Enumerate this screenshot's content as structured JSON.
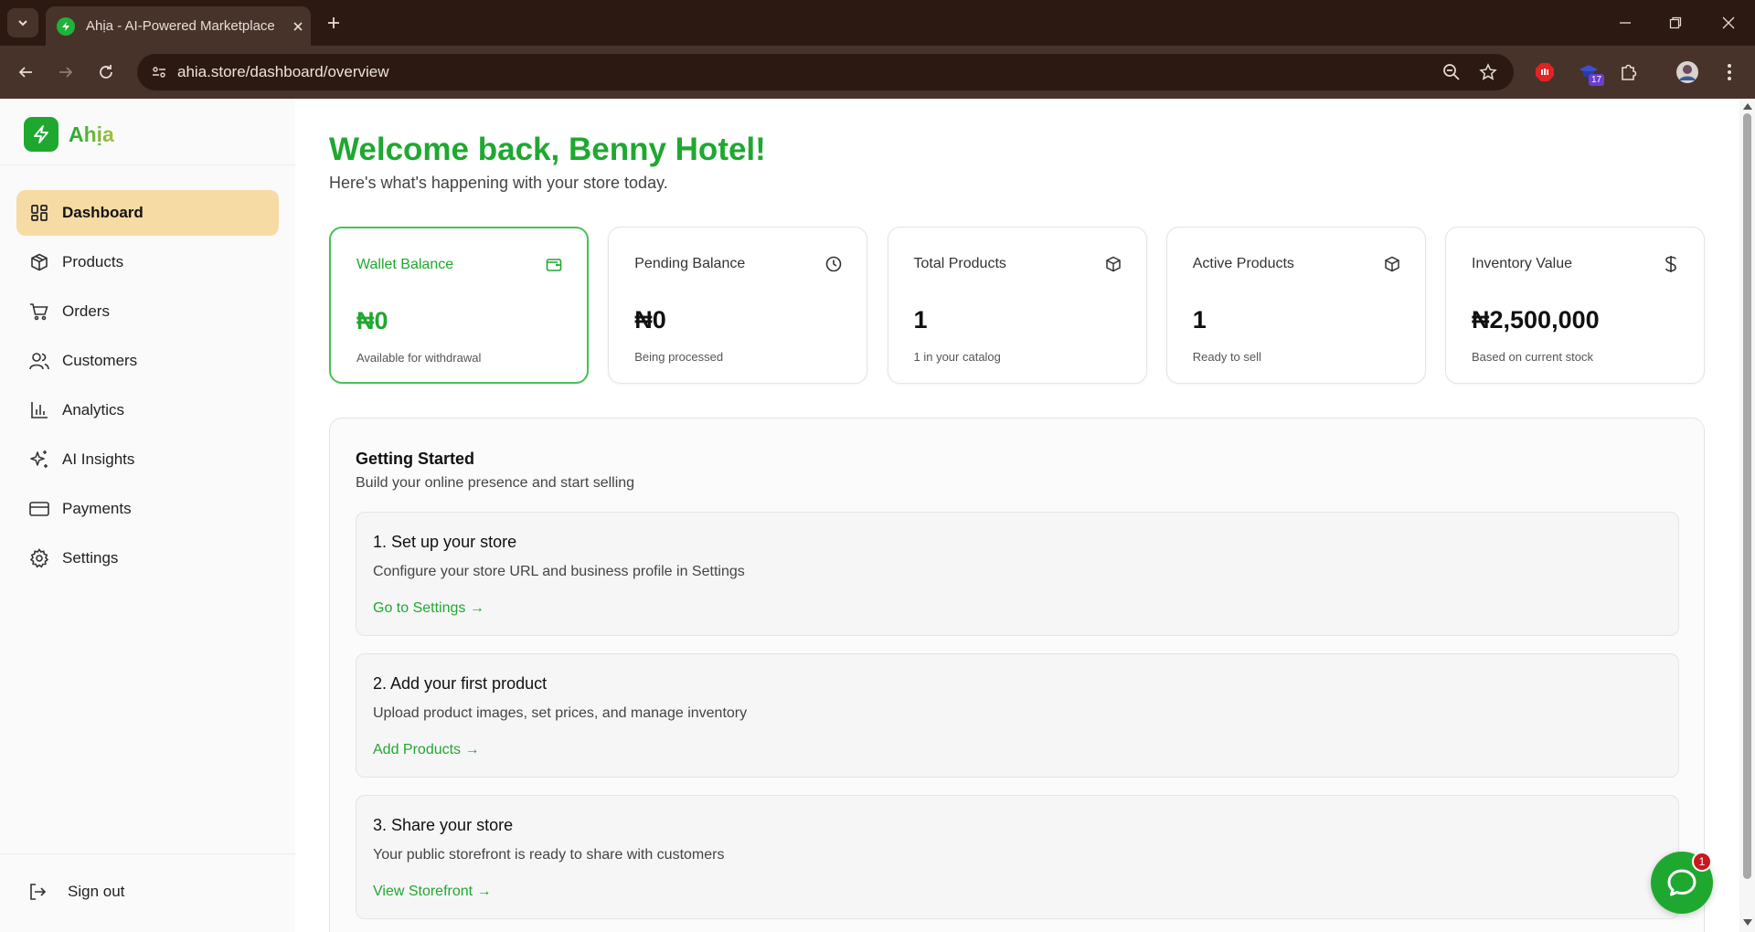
{
  "browser": {
    "tab_title": "Ahịa - AI-Powered Marketplace",
    "url": "ahia.store/dashboard/overview",
    "extension_badge": "17"
  },
  "brand": {
    "name": "Ahịa"
  },
  "sidebar": {
    "items": [
      {
        "label": "Dashboard",
        "icon": "dashboard-icon",
        "active": true
      },
      {
        "label": "Products",
        "icon": "package-icon"
      },
      {
        "label": "Orders",
        "icon": "cart-icon"
      },
      {
        "label": "Customers",
        "icon": "users-icon"
      },
      {
        "label": "Analytics",
        "icon": "bar-chart-icon"
      },
      {
        "label": "AI Insights",
        "icon": "sparkles-icon"
      },
      {
        "label": "Payments",
        "icon": "credit-card-icon"
      },
      {
        "label": "Settings",
        "icon": "gear-icon"
      }
    ],
    "signout": "Sign out"
  },
  "header": {
    "title": "Welcome back, Benny Hotel!",
    "subtitle": "Here's what's happening with your store today."
  },
  "stats": [
    {
      "title": "Wallet Balance",
      "value": "₦0",
      "caption": "Available for withdrawal",
      "icon": "wallet-icon"
    },
    {
      "title": "Pending Balance",
      "value": "₦0",
      "caption": "Being processed",
      "icon": "clock-icon"
    },
    {
      "title": "Total Products",
      "value": "1",
      "caption": "1 in your catalog",
      "icon": "package-icon"
    },
    {
      "title": "Active Products",
      "value": "1",
      "caption": "Ready to sell",
      "icon": "package-icon"
    },
    {
      "title": "Inventory Value",
      "value": "₦2,500,000",
      "caption": "Based on current stock",
      "icon": "dollar-icon"
    }
  ],
  "getting_started": {
    "title": "Getting Started",
    "subtitle": "Build your online presence and start selling",
    "steps": [
      {
        "title": "1. Set up your store",
        "desc": "Configure your store URL and business profile in Settings",
        "link": "Go to Settings →"
      },
      {
        "title": "2. Add your first product",
        "desc": "Upload product images, set prices, and manage inventory",
        "link": "Add Products →"
      },
      {
        "title": "3. Share your store",
        "desc": "Your public storefront is ready to share with customers",
        "link": "View Storefront →"
      }
    ]
  },
  "chat": {
    "badge": "1"
  },
  "colors": {
    "brand_green": "#1fa830",
    "active_nav": "#f7dba4",
    "chrome_dark": "#2c1a12",
    "chrome": "#47332a"
  }
}
